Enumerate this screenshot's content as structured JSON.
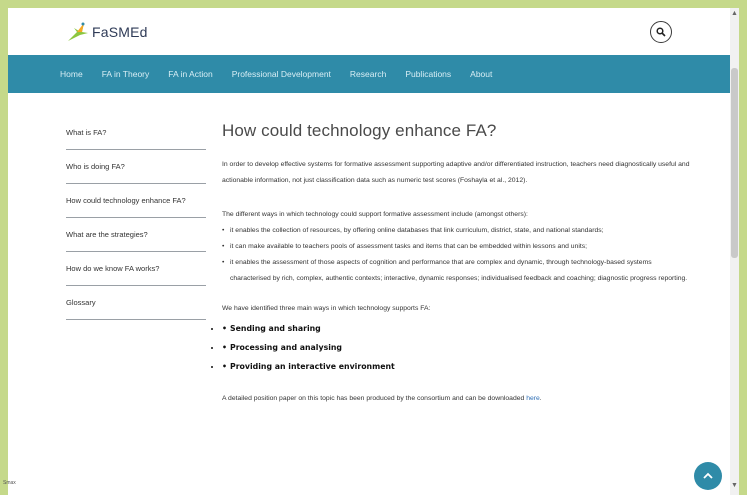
{
  "logo": {
    "text": "FaSMEd"
  },
  "nav": {
    "items": [
      "Home",
      "FA in Theory",
      "FA in Action",
      "Professional Development",
      "Research",
      "Publications",
      "About"
    ]
  },
  "sidebar": {
    "items": [
      {
        "label": "What is FA?"
      },
      {
        "label": "Who is doing FA?"
      },
      {
        "label": "How could technology enhance FA?"
      },
      {
        "label": "What are the strategies?"
      },
      {
        "label": "How do we know FA works?"
      },
      {
        "label": "Glossary"
      }
    ]
  },
  "main": {
    "title": "How could technology enhance FA?",
    "intro": "In order to develop effective systems for formative assessment supporting adaptive and/or differentiated instruction, teachers need diagnostically useful and actionable information, not just classification data such as numeric test scores (Foshayla et al., 2012).",
    "ways_intro": "The different ways in which technology could support formative assessment include (amongst others):",
    "bullets": [
      "it enables the collection of resources, by offering online databases that link curriculum, district, state, and national standards;",
      "it can make available to teachers pools of assessment tasks and items that can be embedded within lessons and units;",
      "it enables the assessment of those aspects of cognition and performance that are complex and dynamic, through technology-based systems characterised by rich, complex, authentic contexts; interactive, dynamic responses; individualised feedback and coaching; diagnostic progress reporting."
    ],
    "main_ways_intro": "We have identified three main ways in which technology supports FA:",
    "main_ways": [
      "Sending and sharing",
      "Processing and analysing",
      "Providing an interactive environment"
    ],
    "paper_text": "A detailed position paper on this topic has been produced by the consortium and can be downloaded ",
    "paper_link": "here",
    "paper_end": "."
  },
  "status": {
    "text": "Smax"
  },
  "colors": {
    "nav_bg": "#2f8ba8",
    "page_bg": "#c5d98a",
    "link": "#2f6fb5"
  }
}
